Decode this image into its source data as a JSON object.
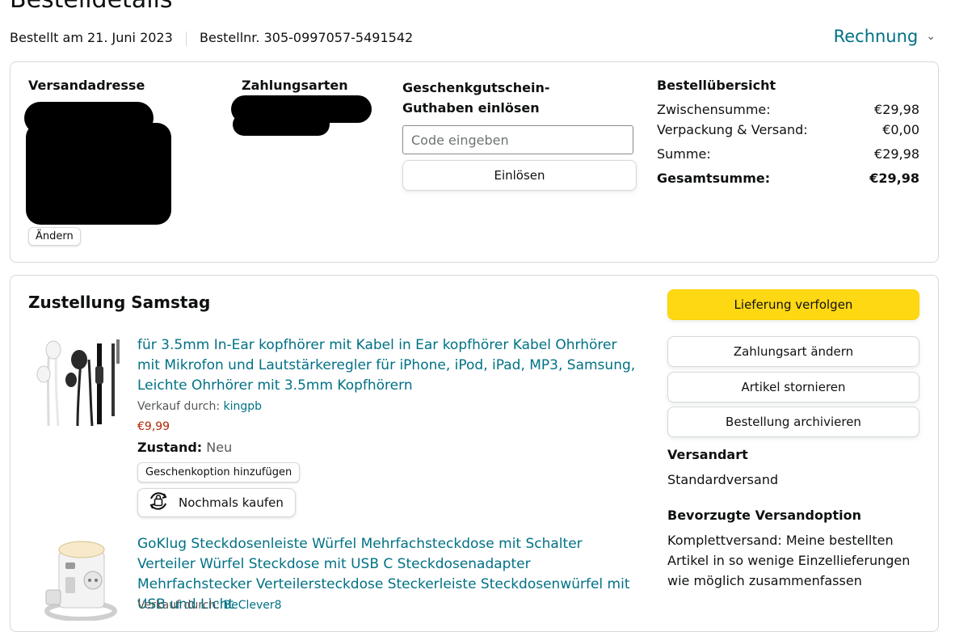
{
  "page": {
    "title": "Bestelldetails",
    "order_date": "Bestellt am 21. Juni 2023",
    "order_number": "Bestellnr. 305-0997057-5491542",
    "invoice_label": "Rechnung"
  },
  "summary_card": {
    "shipping_address_heading": "Versandadresse",
    "change_label": "Ändern",
    "payment_heading": "Zahlungsarten",
    "gift_card_heading": "Geschenkgutschein-Guthaben einlösen",
    "code_placeholder": "Code eingeben",
    "redeem_label": "Einlösen",
    "order_overview_heading": "Bestellübersicht",
    "rows": [
      {
        "label": "Zwischensumme:",
        "value": "€29,98"
      },
      {
        "label": "Verpackung & Versand:",
        "value": "€0,00"
      },
      {
        "label": "Summe:",
        "value": "€29,98"
      },
      {
        "label": "Gesamtsumme:",
        "value": "€29,98"
      }
    ]
  },
  "delivery": {
    "heading": "Zustellung Samstag",
    "items": [
      {
        "title": "für 3.5mm In-Ear kopfhörer mit Kabel in Ear kopfhörer Kabel Ohrhörer mit Mikrofon und Lautstärkeregler für iPhone, iPod, iPad, MP3, Samsung, Leichte Ohrhörer mit 3.5mm Kopfhörern",
        "sold_by_label": "Verkauf durch:",
        "seller": "kingpb",
        "price": "€9,99",
        "condition_label": "Zustand:",
        "condition": "Neu",
        "gift_option_label": "Geschenkoption hinzufügen",
        "buy_again_label": "Nochmals kaufen"
      },
      {
        "title": "GoKlug Steckdosenleiste Würfel Mehrfachsteckdose mit Schalter Verteiler Würfel Steckdose mit USB C Steckdosenadapter Mehrfachstecker Verteilersteckdose Steckerleiste Steckdosenwürfel mit USB und Licht",
        "sold_by_label": "Verkauf durch:",
        "seller": "BeClever8"
      }
    ],
    "actions": {
      "track": "Lieferung verfolgen",
      "change_payment": "Zahlungsart ändern",
      "cancel_items": "Artikel stornieren",
      "archive_order": "Bestellung archivieren"
    },
    "shipping_method_heading": "Versandart",
    "shipping_method": "Standardversand",
    "preferred_option_heading": "Bevorzugte Versandoption",
    "preferred_option": "Komplettversand: Meine bestellten Artikel in so wenige Einzellieferungen wie möglich zusammenfassen"
  },
  "colors": {
    "link": "#007185",
    "price": "#b12704",
    "primary_button": "#ffd814",
    "border": "#d5d9d9"
  },
  "icons": [
    "chevron-down-icon",
    "buy-again-icon"
  ]
}
